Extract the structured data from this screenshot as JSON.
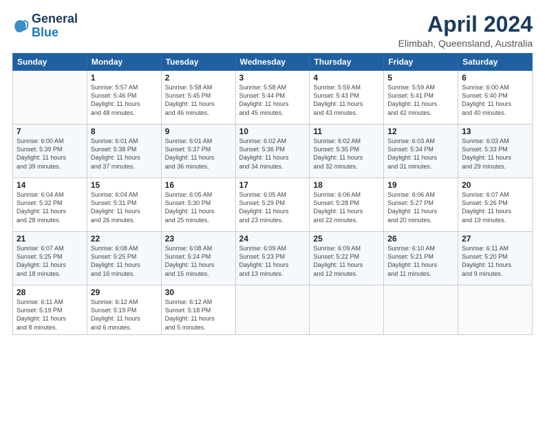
{
  "logo": {
    "line1": "General",
    "line2": "Blue"
  },
  "title": "April 2024",
  "subtitle": "Elimbah, Queensland, Australia",
  "weekdays": [
    "Sunday",
    "Monday",
    "Tuesday",
    "Wednesday",
    "Thursday",
    "Friday",
    "Saturday"
  ],
  "weeks": [
    [
      {
        "day": "",
        "info": ""
      },
      {
        "day": "1",
        "info": "Sunrise: 5:57 AM\nSunset: 5:46 PM\nDaylight: 11 hours\nand 48 minutes."
      },
      {
        "day": "2",
        "info": "Sunrise: 5:58 AM\nSunset: 5:45 PM\nDaylight: 11 hours\nand 46 minutes."
      },
      {
        "day": "3",
        "info": "Sunrise: 5:58 AM\nSunset: 5:44 PM\nDaylight: 11 hours\nand 45 minutes."
      },
      {
        "day": "4",
        "info": "Sunrise: 5:59 AM\nSunset: 5:43 PM\nDaylight: 11 hours\nand 43 minutes."
      },
      {
        "day": "5",
        "info": "Sunrise: 5:59 AM\nSunset: 5:41 PM\nDaylight: 11 hours\nand 42 minutes."
      },
      {
        "day": "6",
        "info": "Sunrise: 6:00 AM\nSunset: 5:40 PM\nDaylight: 11 hours\nand 40 minutes."
      }
    ],
    [
      {
        "day": "7",
        "info": "Sunrise: 6:00 AM\nSunset: 5:39 PM\nDaylight: 11 hours\nand 39 minutes."
      },
      {
        "day": "8",
        "info": "Sunrise: 6:01 AM\nSunset: 5:38 PM\nDaylight: 11 hours\nand 37 minutes."
      },
      {
        "day": "9",
        "info": "Sunrise: 6:01 AM\nSunset: 5:37 PM\nDaylight: 11 hours\nand 36 minutes."
      },
      {
        "day": "10",
        "info": "Sunrise: 6:02 AM\nSunset: 5:36 PM\nDaylight: 11 hours\nand 34 minutes."
      },
      {
        "day": "11",
        "info": "Sunrise: 6:02 AM\nSunset: 5:35 PM\nDaylight: 11 hours\nand 32 minutes."
      },
      {
        "day": "12",
        "info": "Sunrise: 6:03 AM\nSunset: 5:34 PM\nDaylight: 11 hours\nand 31 minutes."
      },
      {
        "day": "13",
        "info": "Sunrise: 6:03 AM\nSunset: 5:33 PM\nDaylight: 11 hours\nand 29 minutes."
      }
    ],
    [
      {
        "day": "14",
        "info": "Sunrise: 6:04 AM\nSunset: 5:32 PM\nDaylight: 11 hours\nand 28 minutes."
      },
      {
        "day": "15",
        "info": "Sunrise: 6:04 AM\nSunset: 5:31 PM\nDaylight: 11 hours\nand 26 minutes."
      },
      {
        "day": "16",
        "info": "Sunrise: 6:05 AM\nSunset: 5:30 PM\nDaylight: 11 hours\nand 25 minutes."
      },
      {
        "day": "17",
        "info": "Sunrise: 6:05 AM\nSunset: 5:29 PM\nDaylight: 11 hours\nand 23 minutes."
      },
      {
        "day": "18",
        "info": "Sunrise: 6:06 AM\nSunset: 5:28 PM\nDaylight: 11 hours\nand 22 minutes."
      },
      {
        "day": "19",
        "info": "Sunrise: 6:06 AM\nSunset: 5:27 PM\nDaylight: 11 hours\nand 20 minutes."
      },
      {
        "day": "20",
        "info": "Sunrise: 6:07 AM\nSunset: 5:26 PM\nDaylight: 11 hours\nand 19 minutes."
      }
    ],
    [
      {
        "day": "21",
        "info": "Sunrise: 6:07 AM\nSunset: 5:25 PM\nDaylight: 11 hours\nand 18 minutes."
      },
      {
        "day": "22",
        "info": "Sunrise: 6:08 AM\nSunset: 5:25 PM\nDaylight: 11 hours\nand 16 minutes."
      },
      {
        "day": "23",
        "info": "Sunrise: 6:08 AM\nSunset: 5:24 PM\nDaylight: 11 hours\nand 15 minutes."
      },
      {
        "day": "24",
        "info": "Sunrise: 6:09 AM\nSunset: 5:23 PM\nDaylight: 11 hours\nand 13 minutes."
      },
      {
        "day": "25",
        "info": "Sunrise: 6:09 AM\nSunset: 5:22 PM\nDaylight: 11 hours\nand 12 minutes."
      },
      {
        "day": "26",
        "info": "Sunrise: 6:10 AM\nSunset: 5:21 PM\nDaylight: 11 hours\nand 11 minutes."
      },
      {
        "day": "27",
        "info": "Sunrise: 6:11 AM\nSunset: 5:20 PM\nDaylight: 11 hours\nand 9 minutes."
      }
    ],
    [
      {
        "day": "28",
        "info": "Sunrise: 6:11 AM\nSunset: 5:19 PM\nDaylight: 11 hours\nand 8 minutes."
      },
      {
        "day": "29",
        "info": "Sunrise: 6:12 AM\nSunset: 5:19 PM\nDaylight: 11 hours\nand 6 minutes."
      },
      {
        "day": "30",
        "info": "Sunrise: 6:12 AM\nSunset: 5:18 PM\nDaylight: 11 hours\nand 5 minutes."
      },
      {
        "day": "",
        "info": ""
      },
      {
        "day": "",
        "info": ""
      },
      {
        "day": "",
        "info": ""
      },
      {
        "day": "",
        "info": ""
      }
    ]
  ]
}
